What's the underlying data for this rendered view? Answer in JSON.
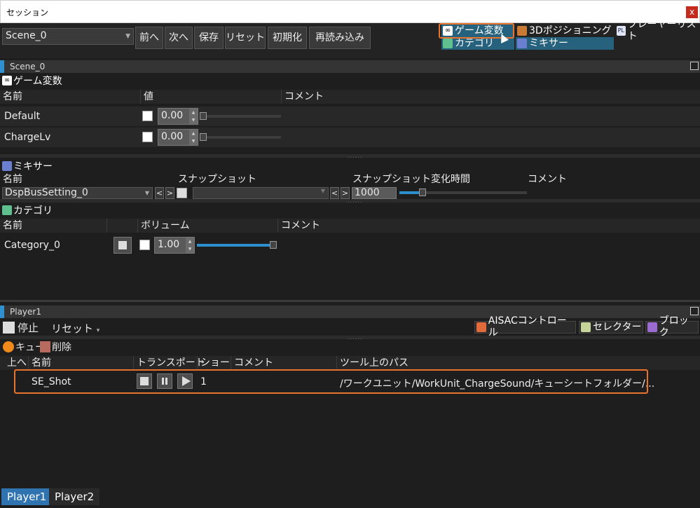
{
  "window": {
    "title": "セッション",
    "close": "x"
  },
  "toolbar": {
    "scene": "Scene_0",
    "buttons": [
      "前へ",
      "次へ",
      "保存",
      "リセット",
      "初期化",
      "再読み込み"
    ],
    "views": {
      "game_variables": "ゲーム変数",
      "positioning_3d": "3Dポジショニング",
      "player_list": "プレーヤーリスト",
      "category": "カテゴリ",
      "mixer": "ミキサー"
    }
  },
  "scene_panel": {
    "title": "Scene_0",
    "game_var": {
      "title": "ゲーム変数",
      "headers": [
        "名前",
        "値",
        "コメント"
      ],
      "rows": [
        {
          "name": "Default",
          "value": "0.00"
        },
        {
          "name": "ChargeLv",
          "value": "0.00"
        }
      ]
    },
    "mixer": {
      "title": "ミキサー",
      "headers": [
        "名前",
        "スナップショット",
        "スナップショット変化時間",
        "コメント"
      ],
      "row": {
        "name": "DspBusSetting_0",
        "prev": "<",
        "next": ">",
        "time": "1000"
      }
    },
    "category": {
      "title": "カテゴリ",
      "headers": [
        "名前",
        "",
        "ボリューム",
        "コメント"
      ],
      "row": {
        "name": "Category_0",
        "volume": "1.00",
        "volume_fraction": 1.0
      }
    }
  },
  "player_panel": {
    "title": "Player1",
    "stop": "停止",
    "reset": "リセット",
    "tools": {
      "aisac": "AISACコントロール",
      "selector": "セレクター",
      "block": "ブロック"
    },
    "cue": "キュー",
    "delete": "削除",
    "headers": [
      "上へ",
      "名前",
      "トランスポート",
      "ショート",
      "コメント",
      "ツール上のパス"
    ],
    "row": {
      "name": "SE_Shot",
      "short": "1",
      "path": "/ワークユニット/WorkUnit_ChargeSound/キューシートフォルダー/..."
    }
  },
  "bottom_tabs": [
    "Player1",
    "Player2"
  ],
  "colors": {
    "accent": "#2f8fcf",
    "highlight": "#e8732c",
    "background": "#1e1e1e"
  }
}
